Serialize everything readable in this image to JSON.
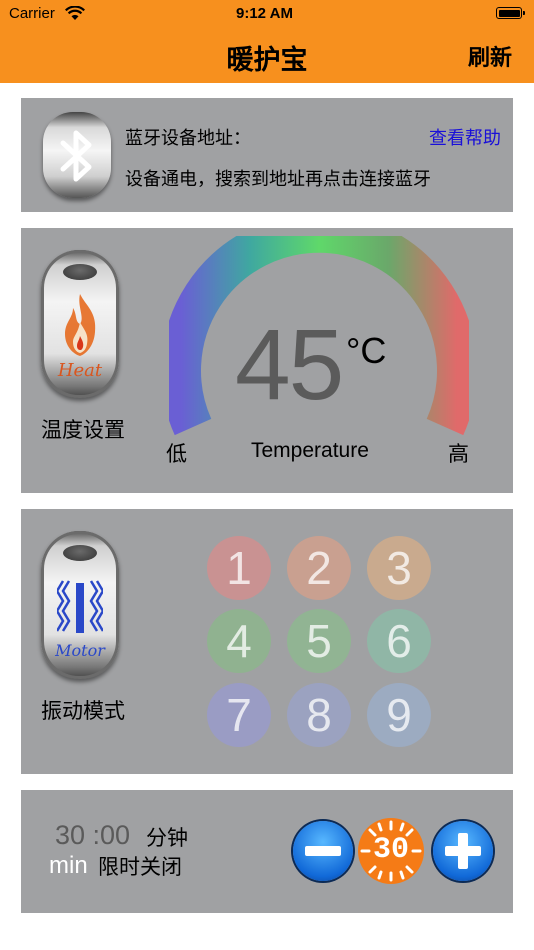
{
  "status_bar": {
    "carrier": "Carrier",
    "time": "9:12 AM"
  },
  "nav": {
    "title": "暖护宝",
    "refresh": "刷新"
  },
  "bluetooth": {
    "address_label": "蓝牙设备地址：",
    "help_link": "查看帮助",
    "instruction": "设备通电，搜索到地址再点击连接蓝牙",
    "icon": "bluetooth-icon"
  },
  "temperature": {
    "button_text": "Heat",
    "label": "温度设置",
    "value": "45",
    "unit": "°C",
    "low": "低",
    "caption": "Temperature",
    "high": "高",
    "gauge_colors": [
      "#6a5fd4",
      "#3fa8a0",
      "#5fd86a",
      "#6aa86a",
      "#e06a6a"
    ]
  },
  "vibration": {
    "button_text": "Motor",
    "label": "振动模式",
    "modes": [
      {
        "label": "1",
        "color": "#c99292"
      },
      {
        "label": "2",
        "color": "#c9a090"
      },
      {
        "label": "3",
        "color": "#c9aa8e"
      },
      {
        "label": "4",
        "color": "#90b290"
      },
      {
        "label": "5",
        "color": "#91b493"
      },
      {
        "label": "6",
        "color": "#90b6a6"
      },
      {
        "label": "7",
        "color": "#9a9cc4"
      },
      {
        "label": "8",
        "color": "#9ba2c0"
      },
      {
        "label": "9",
        "color": "#9cabc1"
      }
    ]
  },
  "timer": {
    "value": "30 :00",
    "unit_en": "min",
    "unit_cn": "分钟",
    "label": "限时关闭",
    "display": "30"
  }
}
